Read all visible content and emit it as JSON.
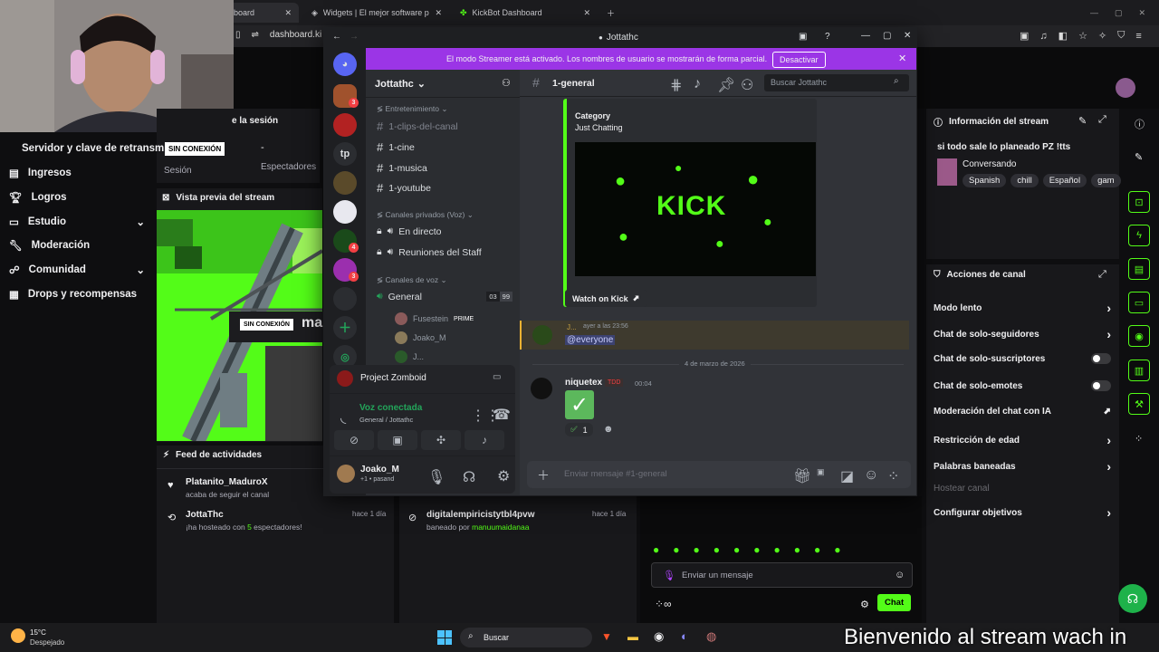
{
  "browser": {
    "tabs": [
      {
        "label": "board"
      },
      {
        "label": "Widgets | El mejor software para pot"
      },
      {
        "label": "KickBot Dashboard"
      }
    ],
    "address": "dashboard.ki"
  },
  "kick": {
    "session_title": "e la sesión",
    "server_key_label": "Servidor y clave de retransm",
    "offline_badge": "SIN CONEXIÓN",
    "session_label": "Sesión",
    "viewers_value": "-",
    "viewers_label": "Espectadores",
    "nav": [
      {
        "label": "Ingresos"
      },
      {
        "label": "Logros"
      },
      {
        "label": "Estudio"
      },
      {
        "label": "Moderación"
      },
      {
        "label": "Comunidad"
      },
      {
        "label": "Drops y recompensas"
      }
    ],
    "preview": {
      "title": "Vista previa del stream",
      "badge": "SIN CONEXIÓN",
      "overlay_text": "ma"
    },
    "activity": {
      "title": "Feed de actividades",
      "items": [
        {
          "name": "Platanito_MaduroX",
          "desc": "acaba de seguir el canal",
          "time": ""
        },
        {
          "name": "JottaThc",
          "desc_pre": "¡ha hosteado con ",
          "desc_num": "5",
          "desc_post": " espectadores!",
          "time": "hace 1 día"
        }
      ]
    },
    "moderation_feed": {
      "items": [
        {
          "name": "digitalempiricistytbl4pvw",
          "desc_pre": "baneado por ",
          "desc_by": "manuumaidanaa",
          "time": "hace 1 día"
        }
      ]
    },
    "stream_info": {
      "title": "Información del stream",
      "stream_title": "si todo sale lo planeado PZ !tts",
      "category": "Conversando",
      "tags": [
        "Spanish",
        "chill",
        "Español",
        "gam"
      ]
    },
    "channel_actions": {
      "title": "Acciones de canal",
      "items": [
        {
          "label": "Modo lento",
          "control": "chevron"
        },
        {
          "label": "Chat de solo-seguidores",
          "control": "chevron"
        },
        {
          "label": "Chat de solo-suscriptores",
          "control": "toggle"
        },
        {
          "label": "Chat de solo-emotes",
          "control": "toggle"
        },
        {
          "label": "Moderación del chat con IA",
          "control": "external"
        },
        {
          "label": "Restricción de edad",
          "control": "chevron"
        },
        {
          "label": "Palabras baneadas",
          "control": "chevron"
        },
        {
          "label": "Hostear canal",
          "control": "disabled"
        },
        {
          "label": "Configurar objetivos",
          "control": "chevron"
        }
      ]
    },
    "chat": {
      "placeholder": "Enviar un mensaje",
      "send_label": "Chat",
      "accent": "#53fc18"
    }
  },
  "discord": {
    "window_title": "Jottathc",
    "banner": {
      "text": "El modo Streamer está activado. Los nombres de usuario se mostrarán de forma parcial.",
      "button": "Desactivar",
      "color": "#9b35e6"
    },
    "server_name": "Jottathc",
    "server_icons": [
      {
        "label": "",
        "badge": "3"
      },
      {
        "label": "",
        "badge": ""
      },
      {
        "label": "tp",
        "badge": ""
      },
      {
        "label": "",
        "badge": ""
      },
      {
        "label": "",
        "badge": ""
      },
      {
        "label": "",
        "badge": "4"
      },
      {
        "label": "",
        "badge": "3"
      },
      {
        "label": "",
        "badge": ""
      }
    ],
    "categories": [
      {
        "label": "Entretenimiento"
      },
      {
        "label": "Canales privados (Voz)"
      },
      {
        "label": "Canales de voz"
      }
    ],
    "channels": [
      {
        "label": "1-clips-del-canal",
        "muted": true
      },
      {
        "label": "1-cine",
        "muted": false
      },
      {
        "label": "1-musica",
        "muted": false
      },
      {
        "label": "1-youtube",
        "muted": false
      },
      {
        "label": "En directo",
        "muted": false
      },
      {
        "label": "Reuniones del Staff",
        "muted": false
      },
      {
        "label": "General",
        "muted": false
      }
    ],
    "voice_counter": {
      "current": "03",
      "max": "99"
    },
    "voice_users": [
      {
        "name": "Fusestein",
        "tag": "PRIME"
      },
      {
        "name": "Joako_M",
        "tag": ""
      },
      {
        "name": "J...",
        "tag": ""
      }
    ],
    "activity_game": "Project Zomboid",
    "voice_status": "Voz conectada",
    "voice_channel": "General / Jottathc",
    "user": {
      "name": "Joako_M",
      "status": "+1 • pasand"
    },
    "channel_header": "1-general",
    "search_placeholder": "Buscar Jottathc",
    "embed": {
      "category_label": "Category",
      "category_value": "Just Chatting",
      "image_text": "KICK",
      "button": "Watch on Kick"
    },
    "messages": [
      {
        "author": "J...",
        "time": "ayer a las 23:56",
        "text": "@everyone"
      },
      {
        "author": "niquetex",
        "tag": "TDD",
        "time": "00:04",
        "reaction_count": "1"
      }
    ],
    "date_divider": "4 de marzo de 2026",
    "composer_placeholder": "Enviar mensaje #1-general"
  },
  "taskbar": {
    "weather_temp": "15°C",
    "weather_desc": "Despejado",
    "search_label": "Buscar",
    "marquee": "Bienvenido al stream wach in"
  }
}
